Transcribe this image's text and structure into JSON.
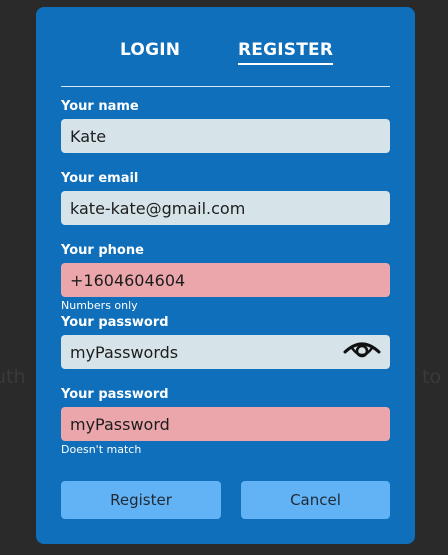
{
  "background": {
    "left_fragment": "uth",
    "right_fragment": "to"
  },
  "tabs": [
    {
      "label": "LOGIN",
      "active": false
    },
    {
      "label": "REGISTER",
      "active": true
    }
  ],
  "form": {
    "name": {
      "label": "Your name",
      "value": "Kate"
    },
    "email": {
      "label": "Your email",
      "value": "kate-kate@gmail.com"
    },
    "phone": {
      "label": "Your phone",
      "value": "+1604604604",
      "hint": "Numbers only",
      "state": "error"
    },
    "password": {
      "label": "Your password",
      "value": "myPasswords",
      "toggle_icon": "eye-icon"
    },
    "password_confirm": {
      "label": "Your password",
      "value": "myPassword",
      "hint": "Doesn't match",
      "state": "error"
    }
  },
  "buttons": {
    "register": "Register",
    "cancel": "Cancel"
  },
  "colors": {
    "modal": "#0f6fba",
    "field": "#d6e4ea",
    "field_error": "#eaa6aa",
    "button": "#62b3f5",
    "page_background": "#2a2a2a"
  }
}
